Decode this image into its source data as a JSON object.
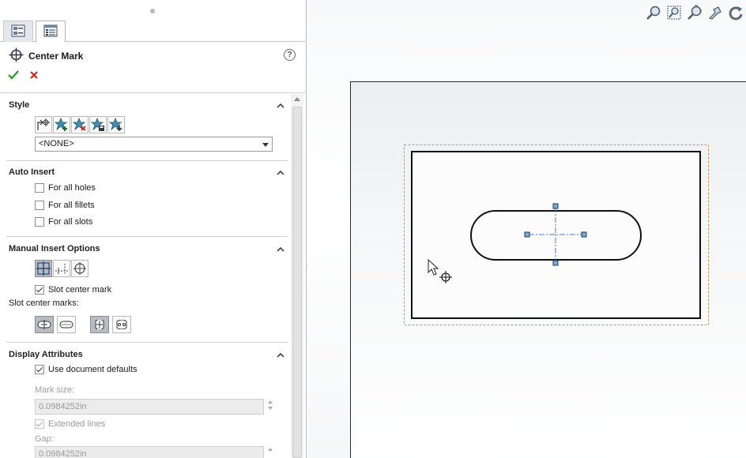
{
  "panel": {
    "tabs": [
      {
        "icon": "feature-manager-tree-icon"
      },
      {
        "icon": "property-manager-icon",
        "active": true
      }
    ],
    "title": "Center Mark",
    "help_icon": "question-icon",
    "help_glyph": "?",
    "ok_icon": "checkmark-icon",
    "cancel_icon": "x-icon"
  },
  "style": {
    "header": "Style",
    "buttons": [
      "apply-default-style-icon",
      "add-style-icon",
      "delete-style-icon",
      "save-style-icon",
      "load-style-icon"
    ],
    "selected": "<NONE>"
  },
  "auto_insert": {
    "header": "Auto Insert",
    "options": [
      {
        "label": "For all holes",
        "checked": false
      },
      {
        "label": "For all fillets",
        "checked": false
      },
      {
        "label": "For all slots",
        "checked": false
      }
    ]
  },
  "manual_insert": {
    "header": "Manual Insert Options",
    "mode_buttons": [
      "single-center-mark-icon",
      "linear-center-mark-icon",
      "circular-center-mark-icon"
    ],
    "slot_center_mark_label": "Slot center mark",
    "slot_center_mark_checked": true,
    "slot_marks_label": "Slot center marks:",
    "slot_buttons": [
      "slot-center-icon",
      "slot-ends-icon",
      "slot-arc-center-icon",
      "slot-arc-ends-icon"
    ]
  },
  "display_attributes": {
    "header": "Display Attributes",
    "use_defaults_label": "Use document defaults",
    "use_defaults_checked": true,
    "mark_size_label": "Mark size:",
    "mark_size_value": "0.0984252in",
    "extended_lines_label": "Extended lines",
    "extended_lines_checked": true,
    "gap_label": "Gap:",
    "gap_value": "0.0984252in"
  },
  "canvas": {
    "hud_icons": [
      "zoom-to-fit-icon",
      "zoom-to-area-icon",
      "zoom-in-out-icon",
      "pan-icon",
      "rotate-icon"
    ]
  },
  "colors": {
    "accent_check": "#2e9a2e",
    "accent_cancel": "#cc2a1a",
    "sketch_line": "#111111",
    "centerline": "#4a78c8",
    "boundary": "#e08a4a"
  }
}
